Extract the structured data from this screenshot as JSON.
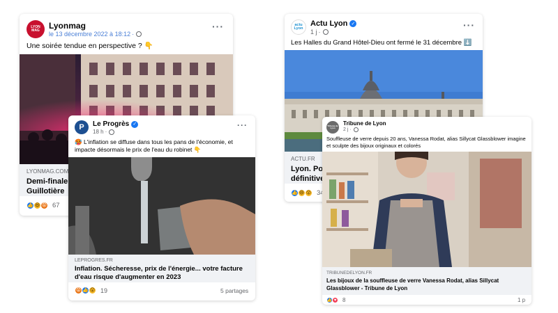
{
  "posts": {
    "lyonmag": {
      "page_name": "Lyonmag",
      "avatar_text": "LYON MAG",
      "date": "le 13 décembre 2022 à 18:12",
      "separator": "·",
      "more": "···",
      "text": "Une soirée tendue en perspective ?",
      "text_emoji": "👇",
      "domain": "LYONMAG.COM",
      "link_title": "Demi-finale du Mondial : les lignes TCL coupées à la Guillotière",
      "reaction_count": "67",
      "colors": {
        "avatar": "#c8102e"
      }
    },
    "leprogres": {
      "page_name": "Le Progrès",
      "avatar_text": "P",
      "time": "18 h",
      "separator": "·",
      "more": "···",
      "text_emoji": "🥵",
      "text": "L'inflation se diffuse dans tous les pans de l'économie, et impacte désormais le prix de l'eau du robinet",
      "text_emoji_end": "👇",
      "domain": "LEPROGRES.FR",
      "link_title": "Inflation. Sécheresse, prix de l'énergie... votre facture d'eau risque d'augmenter en 2023",
      "reaction_count": "19",
      "shares": "5 partages",
      "colors": {
        "avatar": "#1d4f91"
      }
    },
    "actulyon": {
      "page_name": "Actu Lyon",
      "avatar_text": "actu Lyon",
      "time": "1 j",
      "separator": "·",
      "more": "···",
      "text": "Les Halles du Grand Hôtel-Dieu ont fermé le 31 décembre",
      "text_emoji": "⬇️",
      "domain": "ACTU.FR",
      "link_title": "Lyon. Pourquoi les Halles du Grand Hôtel-Dieu ont définitivement fermé",
      "reaction_count": "34",
      "colors": {
        "avatar_text": "#1a8fd0"
      }
    },
    "tribune": {
      "page_name": "Tribune de Lyon",
      "avatar_text": "Tribune de Lyon",
      "time": "2 j",
      "separator": "·",
      "text": "Souffleuse de verre depuis 20 ans, Vanessa Rodat, alias Sillycat Glassblower imagine et sculpte des bijoux originaux et colorés",
      "domain": "TRIBUNEDELYON.FR",
      "link_title": "Les bijoux de la souffleuse de verre Vanessa Rodat, alias Sillycat Glassblower - Tribune de Lyon",
      "reaction_count": "8",
      "shares": "1 p",
      "colors": {
        "avatar": "#6b6b6b"
      }
    }
  },
  "colors": {
    "facebook_blue": "#1877f2",
    "link_bg": "#f0f2f5",
    "meta_text": "#65676b"
  }
}
